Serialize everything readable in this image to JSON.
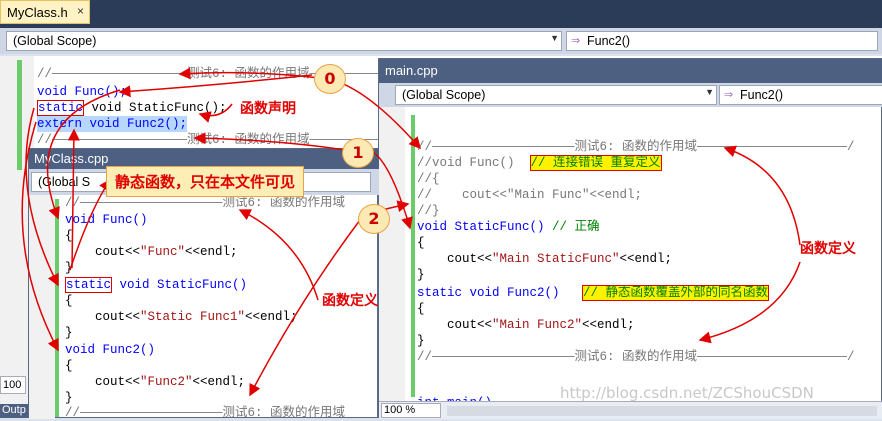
{
  "main": {
    "tab_title": "MyClass.h",
    "tab_close": "×",
    "scope": "(Global Scope)",
    "func": "Func2()",
    "lines": {
      "c1": "//——————————————————测试6: 函数的作用域——————————",
      "l1": "void Func();",
      "l2a": "static",
      "l2b": " void StaticFunc();",
      "l3": "extern void Func2();",
      "c2": "//——————————————————测试6: 函数的作用域——————————"
    },
    "zoom": "100",
    "output": "Outp"
  },
  "win2": {
    "title": "main.cpp",
    "scope": "(Global Scope)",
    "func": "Func2()",
    "zoom": "100 %",
    "lines": {
      "c1": "//———————————————————测试6: 函数的作用域————————————————————/",
      "l1a": "//void Func()  ",
      "l1b": "// 连接错误 重复定义",
      "l2": "//{",
      "l3": "//    cout<<\"Main Func\"<<endl;",
      "l4": "//}",
      "l5a": "void StaticFunc() ",
      "l5b": "// 正确",
      "l6": "{",
      "l7a": "    cout<<",
      "l7b": "\"Main StaticFunc\"",
      "l7c": "<<endl;",
      "l8": "}",
      "l9a": "static void Func2()   ",
      "l9b": "// 静态函数覆盖外部的同名函数",
      "l10": "{",
      "l11a": "    cout<<",
      "l11b": "\"Main Func2\"",
      "l11c": "<<endl;",
      "l12": "}",
      "c2": "//———————————————————测试6: 函数的作用域————————————————————/",
      "l13": "int main()"
    }
  },
  "win3": {
    "title": "MyClass.cpp",
    "scope": "(Global S",
    "lines": {
      "c1": "//———————————————————测试6: 函数的作用域",
      "l1": "void Func()",
      "l2": "{",
      "l3a": "    cout<<",
      "l3b": "\"Func\"",
      "l3c": "<<endl;",
      "l4": "}",
      "l5a": "static",
      "l5b": " void StaticFunc()",
      "l6": "{",
      "l7a": "    cout<<",
      "l7b": "\"Static Func1\"",
      "l7c": "<<endl;",
      "l8": "}",
      "l9": "void Func2()",
      "l10": "{",
      "l11a": "    cout<<",
      "l11b": "\"Func2\"",
      "l11c": "<<endl;",
      "l12": "}",
      "c2": "//———————————————————测试6: 函数的作用域"
    }
  },
  "annotations": {
    "decl": "函数声明",
    "static_note": "静态函数，只在本文件可见",
    "def1": "函数定义",
    "def2": "函数定义",
    "n0": "0",
    "n1": "1",
    "n2": "2",
    "watermark": "http://blog.csdn.net/ZCShouCSDN"
  }
}
